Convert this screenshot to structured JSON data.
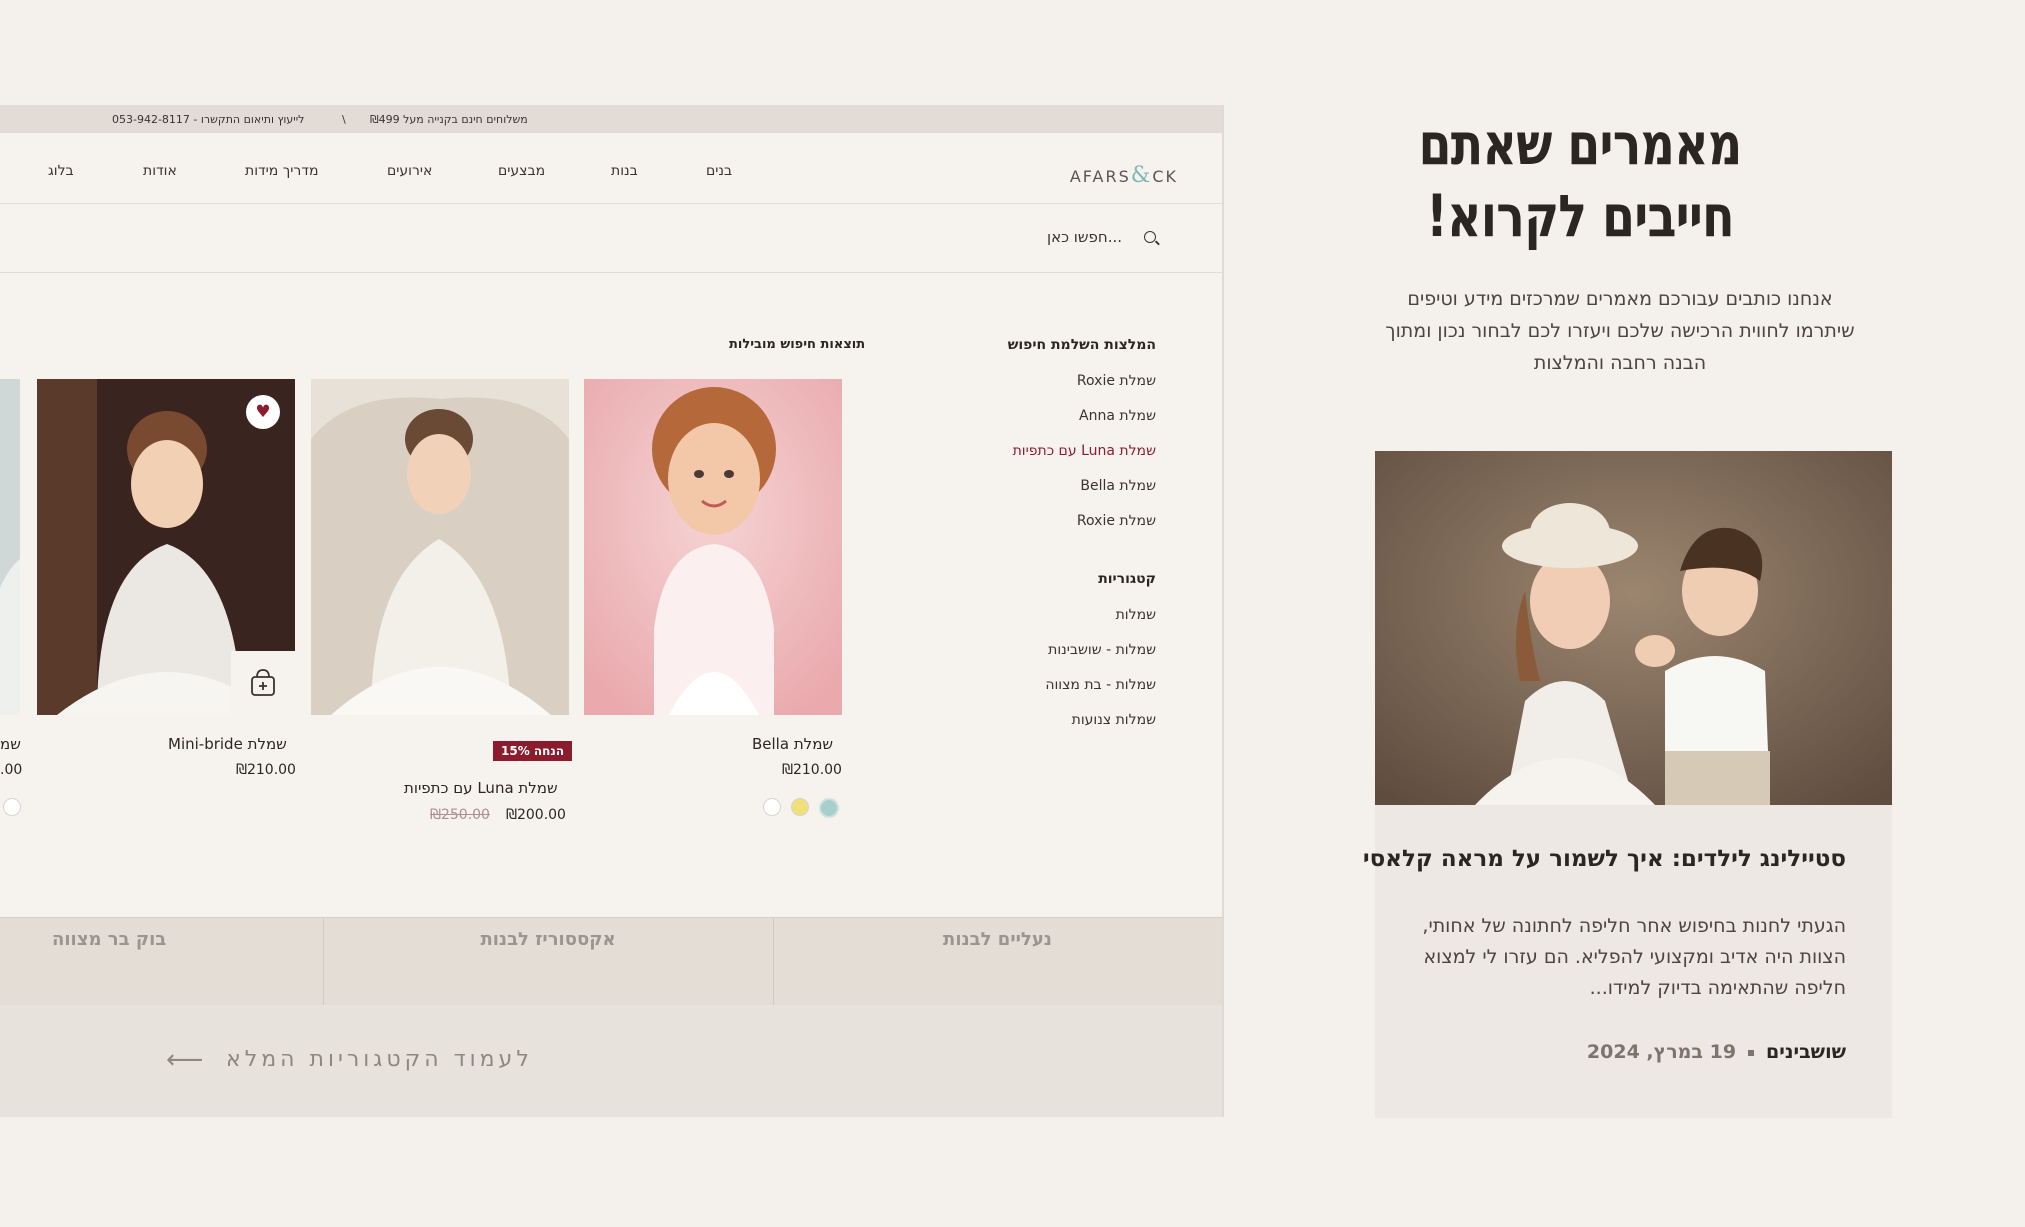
{
  "topbar": {
    "shipping": "משלוחים חינם בקנייה מעל ₪499",
    "separator": "\\",
    "contact": "לייעוץ ותיאום התקשרו - 053-942-8117"
  },
  "brand": {
    "logo_left": "AFARS",
    "logo_amp": "&",
    "logo_right": "CK"
  },
  "nav": [
    "בנים",
    "בנות",
    "מבצעים",
    "אירועים",
    "מדריך מידות",
    "אודות",
    "בלוג"
  ],
  "search": {
    "placeholder": "חפשו כאן..."
  },
  "suggestions": {
    "title": "המלצות השלמת חיפוש",
    "items": [
      "שמלת Roxie",
      "שמלת Anna",
      "שמלת Luna עם כתפיות",
      "שמלת Bella",
      "שמלת Roxie"
    ]
  },
  "categories": {
    "title": "קטגוריות",
    "items": [
      "שמלות",
      "שמלות - שושבינות",
      "שמלות - בת מצווה",
      "שמלות צנועות"
    ]
  },
  "results": {
    "title": "תוצאות חיפוש מובילות",
    "products": [
      {
        "name": "שמלת Bella",
        "price": "₪210.00"
      },
      {
        "name": "שמלת Luna עם כתפיות",
        "price": "₪200.00",
        "old_price": "₪250.00",
        "badge": "15% הנחה"
      },
      {
        "name": "שמלת Mini-bride",
        "price": "₪210.00"
      },
      {
        "name": "שמ",
        "price": ".00"
      }
    ]
  },
  "tabs": [
    "נעליים לבנות",
    "אקססוריז לבנות",
    "בוק בר מצווה"
  ],
  "category_link": "לעמוד הקטגוריות המלא",
  "right": {
    "heading_line1": "מאמרים שאתם",
    "heading_line2": "חייבים לקרוא!",
    "intro": "אנחנו כותבים עבורכם מאמרים שמרכזים מידע וטיפים שיתרמו לחווית הרכישה שלכם ויעזרו לכם לבחור נכון ומתוך הבנה רחבה והמלצות",
    "card": {
      "title": "סטיילינג לילדים: איך לשמור על מראה קלאסי",
      "excerpt": "הגעתי לחנות בחיפוש אחר חליפה לחתונה של אחותי, הצוות היה אדיב ומקצועי להפליא. הם עזרו לי למצוא חליפה שהתאימה בדיוק למידו...",
      "category": "שושבינים",
      "date": "19 במרץ, 2024"
    }
  },
  "colors": {
    "accent": "#8a1c2e",
    "background": "#f4f1ed",
    "teal": "#7fb8b2"
  }
}
